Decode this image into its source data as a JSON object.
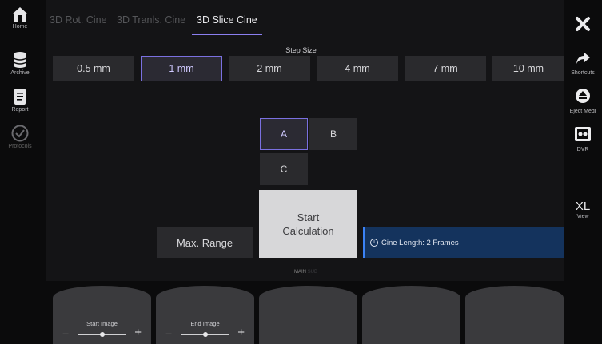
{
  "left_nav": {
    "home": "Home",
    "archive": "Archive",
    "report": "Report",
    "protocols": "Protocols"
  },
  "right_nav": {
    "shortcuts": "Shortcuts",
    "eject": "Eject Medi",
    "dvr": "DVR",
    "view_value": "XL",
    "view": "View"
  },
  "tabs": [
    "3D Rot. Cine",
    "3D Tranls. Cine",
    "3D Slice Cine"
  ],
  "active_tab": "3D Slice Cine",
  "step_size": {
    "title": "Step Size",
    "options": [
      "0.5 mm",
      "1 mm",
      "2 mm",
      "4 mm",
      "7 mm",
      "10 mm"
    ],
    "selected": "1 mm"
  },
  "planes": {
    "options": [
      "A",
      "B",
      "C"
    ],
    "selected": "A"
  },
  "buttons": {
    "max_range": "Max. Range",
    "start_line1": "Start",
    "start_line2": "Calculation"
  },
  "info": {
    "icon": "info-icon",
    "text": "Cine Length: 2 Frames"
  },
  "page_label": {
    "main": "MAIN",
    "next": "SUB"
  },
  "knobs": {
    "start_image": "Start Image",
    "end_image": "End Image",
    "minus": "−",
    "plus": "+"
  },
  "colors": {
    "accent": "#7a70e0",
    "info_bg": "#14335d",
    "start_button": "#d7d7d9"
  }
}
